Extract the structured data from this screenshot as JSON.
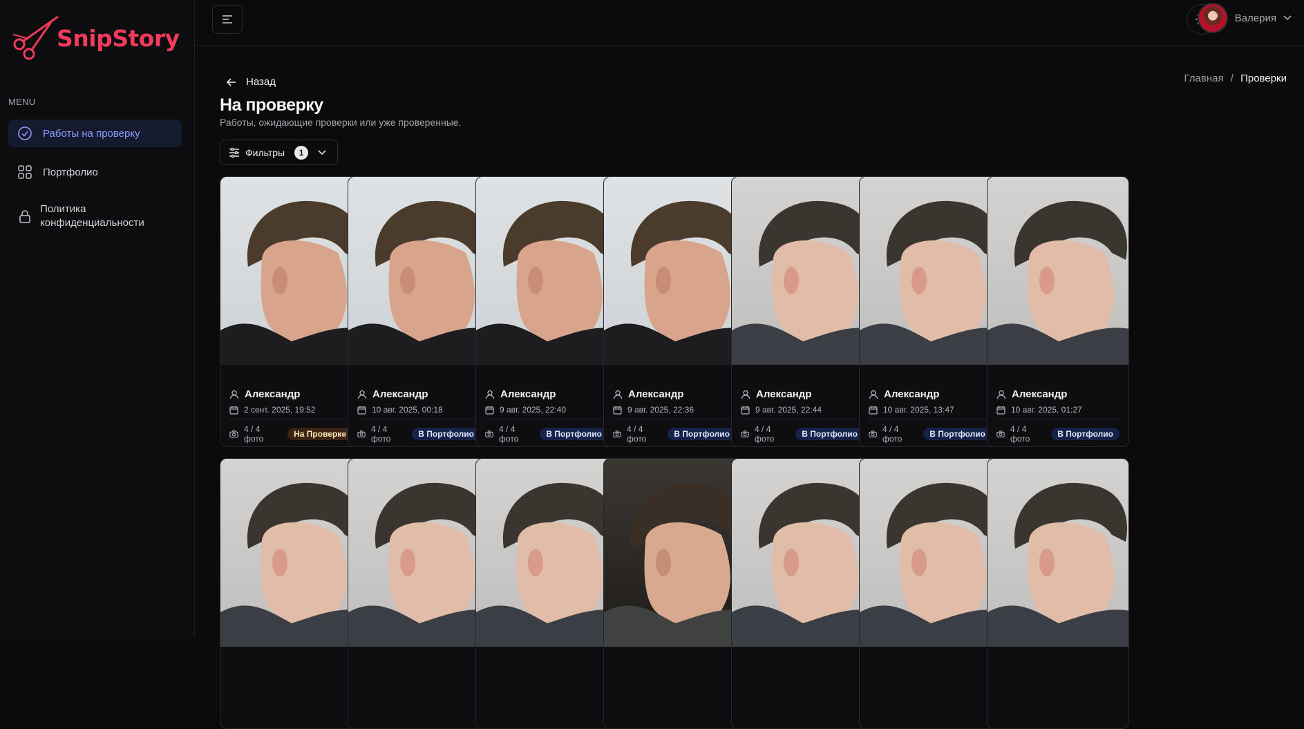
{
  "app": {
    "logo_text": "SnipStory"
  },
  "sidebar": {
    "menu_label": "MENU",
    "items": [
      {
        "label": "Работы на проверку",
        "icon": "check-circle-icon",
        "active": true
      },
      {
        "label": "Портфолио",
        "icon": "grid-icon",
        "active": false
      },
      {
        "label": "Политика конфиденциальности",
        "icon": "lock-icon",
        "active": false
      }
    ]
  },
  "header": {
    "user_name": "Валерия"
  },
  "page": {
    "back_label": "Назад",
    "breadcrumb": {
      "home": "Главная",
      "separator": "/",
      "current": "Проверки"
    },
    "title": "На проверку",
    "subtitle": "Работы, ожидающие проверки или уже проверенные.",
    "filter": {
      "label": "Фильтры",
      "count": "1"
    }
  },
  "cards": [
    {
      "name": "Александр",
      "date": "2 сент. 2025, 19:52",
      "photos": "4 / 4 фото",
      "status": "На Проверке",
      "status_type": "review",
      "photo": "light"
    },
    {
      "name": "Александр",
      "date": "10 авг. 2025, 00:18",
      "photos": "4 / 4 фото",
      "status": "В Портфолио",
      "status_type": "port",
      "photo": "light"
    },
    {
      "name": "Александр",
      "date": "9 авг. 2025, 22:40",
      "photos": "4 / 4 фото",
      "status": "В Портфолио",
      "status_type": "port",
      "photo": "light"
    },
    {
      "name": "Александр",
      "date": "9 авг. 2025, 22:36",
      "photos": "4 / 4 фото",
      "status": "В Портфолио",
      "status_type": "port",
      "photo": "light"
    },
    {
      "name": "Александр",
      "date": "9 авг. 2025, 22:44",
      "photos": "4 / 4 фото",
      "status": "В Портфолио",
      "status_type": "port",
      "photo": "fade"
    },
    {
      "name": "Александр",
      "date": "10 авг. 2025, 13:47",
      "photos": "4 / 4 фото",
      "status": "В Портфолио",
      "status_type": "port",
      "photo": "fade"
    },
    {
      "name": "Александр",
      "date": "10 авг. 2025, 01:27",
      "photos": "4 / 4 фото",
      "status": "В Портфолио",
      "status_type": "port",
      "photo": "fade"
    },
    {
      "photo": "fade"
    },
    {
      "photo": "fade"
    },
    {
      "photo": "fade"
    },
    {
      "photo": "dark"
    },
    {
      "photo": "fade"
    },
    {
      "photo": "fade"
    },
    {
      "photo": "fade"
    }
  ],
  "colors": {
    "accent": "#8f9dff",
    "brand": "#f23b5c",
    "background": "#0b0b0c"
  }
}
